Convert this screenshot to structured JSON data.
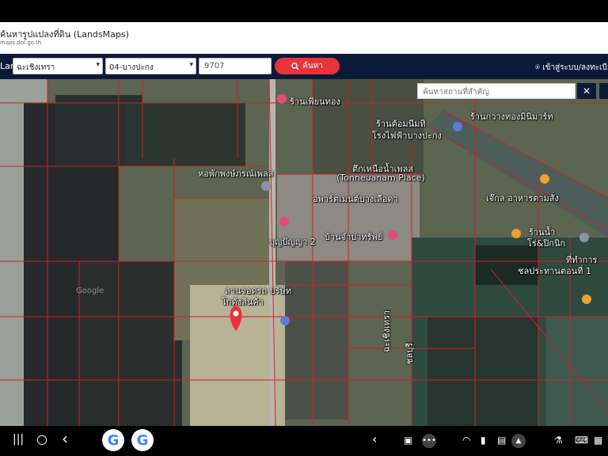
{
  "app": {
    "title": "ค้นหารูปแปลงที่ดิน (LandsMaps)",
    "url": "maps.dol.go.th"
  },
  "navbar": {
    "brand": "LandsMaps",
    "province": "ฉะเชิงเทรา",
    "district": "04-บางปะกง",
    "parcel_number": "9707",
    "search_label": "ค้นหา",
    "login_label": "เข้าสู่ระบบ/ลงทะเบียน"
  },
  "map": {
    "search_placeholder": "ค้นหาสถานที่สำคัญ",
    "pois": [
      "ร้านเพียนทอง",
      "ร้านต้อมนีมทิ",
      "โรงไฟฟ้าบางปะกง",
      "ร้านกวางทองมินิมาร์ท",
      "หอพักพงษ์ภรณ์เพลส",
      "ตึกเหนือน้ำเพลส",
      "(Tonneuanam Place)",
      "อพาร์ตเมนต์บางเลือดา",
      "บุญปัญญา 2",
      "บ้านจำปาทรัพย์",
      "เจ๊กล อาหารตามสั่ง",
      "ร้านน้ำ",
      "โร่&ปิกนิก",
      "ที่ทำการ",
      "ชลประทานตอนที่ 1",
      "ลานจอดรถ บริษัท",
      "โกดังสินค้า",
      "ฉะเชิงเทรา",
      "ชลบุรี"
    ],
    "watermark": "Google"
  },
  "nav_bottom": {
    "recent_label": "|||",
    "home_label": "○",
    "back_label": "‹",
    "app1": "G",
    "app2": "G"
  },
  "colors": {
    "navbar_bg": "#0c1a3a",
    "accent": "#e8323c",
    "parcel_line": "#d21e2a"
  }
}
